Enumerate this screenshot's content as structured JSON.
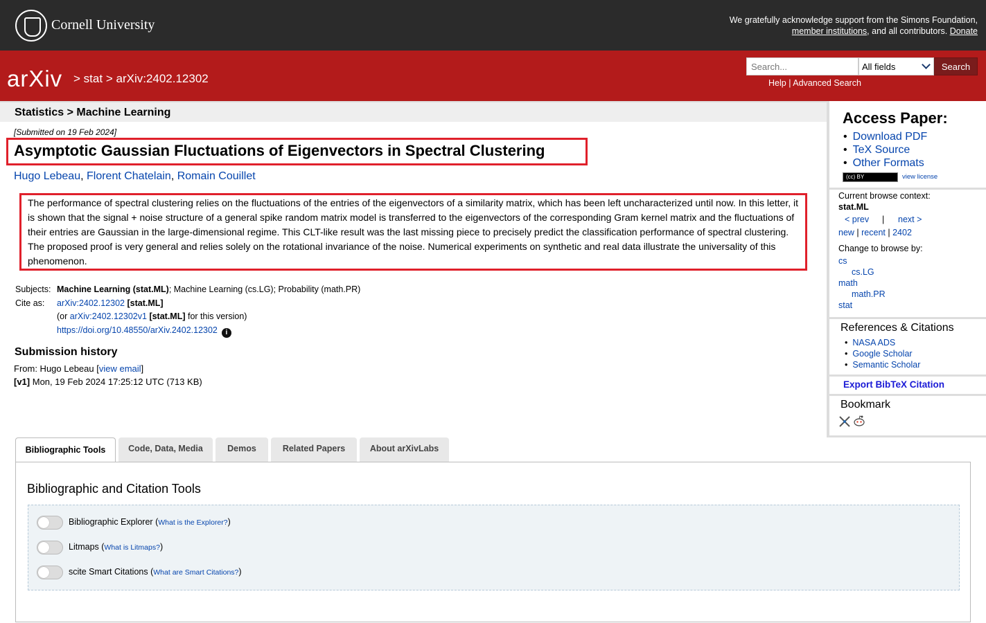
{
  "header": {
    "cornell_name": "Cornell University",
    "ack_line1": "We gratefully acknowledge support from the Simons Foundation,",
    "ack_member": "member institutions",
    "ack_mid": ", and all contributors. ",
    "ack_donate": "Donate"
  },
  "arxiv_bar": {
    "logo": "arXiv",
    "sep1": ">",
    "crumb_stat": "stat",
    "sep2": ">",
    "crumb_id": "arXiv:2402.12302",
    "search_placeholder": "Search...",
    "field_value": "All fields",
    "search_button": "Search",
    "help": "Help",
    "pipe": "|",
    "advanced": "Advanced Search"
  },
  "subheader": "Statistics > Machine Learning",
  "paper": {
    "submitted": "[Submitted on 19 Feb 2024]",
    "title": "Asymptotic Gaussian Fluctuations of Eigenvectors in Spectral Clustering",
    "authors": [
      "Hugo Lebeau",
      "Florent Chatelain",
      "Romain Couillet"
    ],
    "abstract": "The performance of spectral clustering relies on the fluctuations of the entries of the eigenvectors of a similarity matrix, which has been left uncharacterized until now. In this letter, it is shown that the signal + noise structure of a general spike random matrix model is transferred to the eigenvectors of the corresponding Gram kernel matrix and the fluctuations of their entries are Gaussian in the large-dimensional regime. This CLT-like result was the last missing piece to precisely predict the classification performance of spectral clustering. The proposed proof is very general and relies solely on the rotational invariance of the noise. Numerical experiments on synthetic and real data illustrate the universality of this phenomenon."
  },
  "meta": {
    "subjects_label": "Subjects:",
    "subjects_bold": "Machine Learning (stat.ML)",
    "subjects_rest": "; Machine Learning (cs.LG); Probability (math.PR)",
    "cite_label": "Cite as:",
    "cite_id": "arXiv:2402.12302",
    "cite_cat": "[stat.ML]",
    "version_pre": "(or ",
    "version_id": "arXiv:2402.12302v1",
    "version_cat": "[stat.ML]",
    "version_post": " for this version)",
    "doi": "https://doi.org/10.48550/arXiv.2402.12302",
    "info": "i"
  },
  "history": {
    "title": "Submission history",
    "from_pre": "From: Hugo Lebeau [",
    "view_email": "view email",
    "from_post": "]",
    "v1_label": "[v1]",
    "v1_text": " Mon, 19 Feb 2024 17:25:12 UTC (713 KB)"
  },
  "sidebar": {
    "access_title": "Access Paper:",
    "access_items": [
      "Download PDF",
      "TeX Source",
      "Other Formats"
    ],
    "license_badge": "(cc) BY",
    "view_license": "view license",
    "context_label": "Current browse context:",
    "context_value": "stat.ML",
    "prev": "< prev",
    "bar": "|",
    "next": "next >",
    "new": "new",
    "recent": "recent",
    "period": "2402",
    "change_label": "Change to browse by:",
    "browse": [
      "cs",
      "cs.LG",
      "math",
      "math.PR",
      "stat"
    ],
    "refs_title": "References & Citations",
    "refs": [
      "NASA ADS",
      "Google Scholar",
      "Semantic Scholar"
    ],
    "export": "Export BibTeX Citation",
    "bookmark": "Bookmark"
  },
  "tabs": [
    "Bibliographic Tools",
    "Code, Data, Media",
    "Demos",
    "Related Papers",
    "About arXivLabs"
  ],
  "panel": {
    "title": "Bibliographic and Citation Tools",
    "tools": [
      {
        "name": "Bibliographic Explorer",
        "link": "What is the Explorer?"
      },
      {
        "name": "Litmaps",
        "link": "What is Litmaps?"
      },
      {
        "name": "scite Smart Citations",
        "link": "What are Smart Citations?"
      }
    ]
  }
}
